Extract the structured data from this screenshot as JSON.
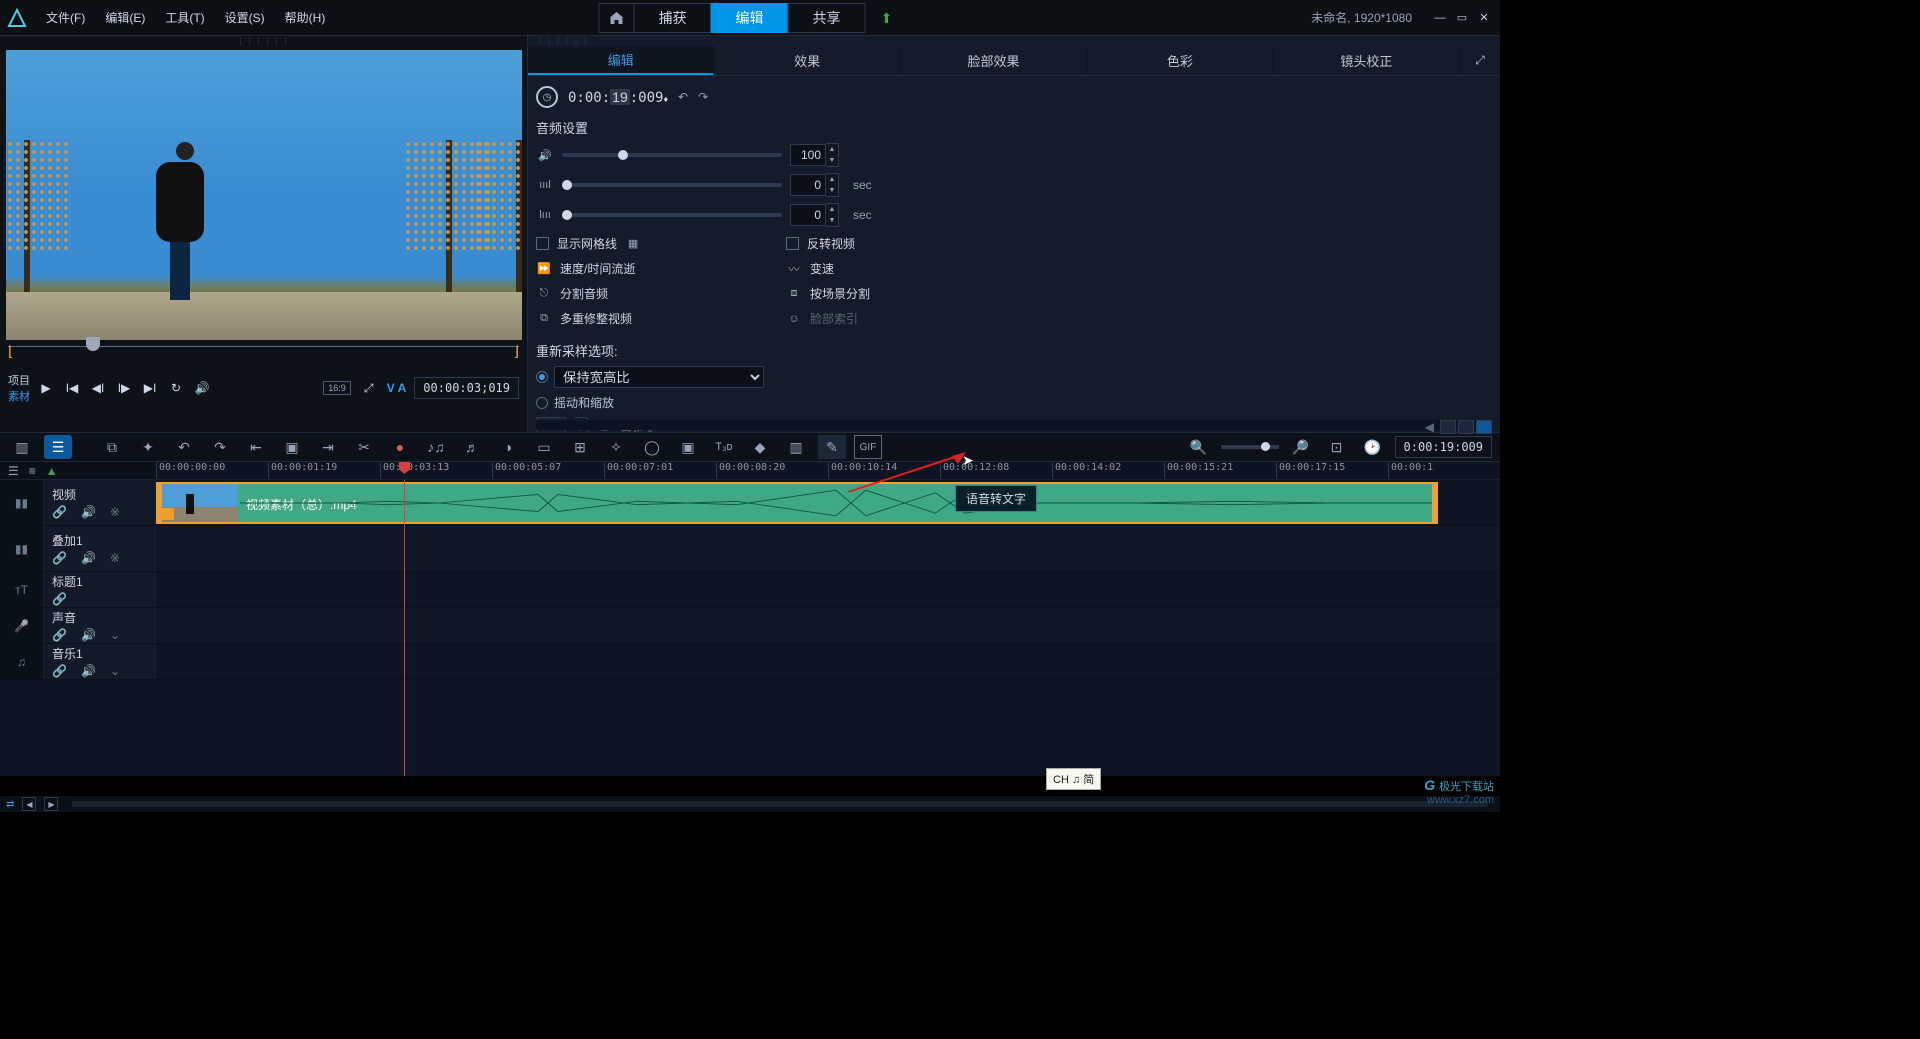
{
  "app": {
    "project_info": "未命名, 1920*1080"
  },
  "menu": [
    "文件(F)",
    "编辑(E)",
    "工具(T)",
    "设置(S)",
    "帮助(H)"
  ],
  "modes": {
    "capture": "捕获",
    "edit": "编辑",
    "share": "共享",
    "active": "编辑"
  },
  "preview": {
    "labels": {
      "project": "项目",
      "clip": "素材"
    },
    "timecode": "00:00:03;019",
    "aspect": "16:9",
    "va": "V A",
    "marker_in": "[",
    "marker_out": "]"
  },
  "edit_panel": {
    "tabs": [
      "编辑",
      "效果",
      "脸部效果",
      "色彩",
      "镜头校正"
    ],
    "active": "编辑",
    "timecode": "0:00:19:009",
    "audio_header": "音频设置",
    "sliders": {
      "volume": {
        "value": "100"
      },
      "fadein": {
        "value": "0",
        "unit": "sec"
      },
      "fadeout": {
        "value": "0",
        "unit": "sec"
      }
    },
    "checks": {
      "grid": "显示网格线",
      "reverse": "反转视频"
    },
    "tools": {
      "speed": "速度/时间流逝",
      "varrate": "变速",
      "split": "分割音频",
      "scene": "按场景分割",
      "multi": "多重修整视频",
      "face": "脸部索引"
    },
    "resample": {
      "header": "重新采样选项:",
      "keep": "保持宽高比",
      "panzoom": "摇动和缩放",
      "custom": "自定义"
    }
  },
  "toolbar": {
    "timecode": "0:00:19:009"
  },
  "ruler": [
    "00:00:00:00",
    "00:00:01:19",
    "00:00:03:13",
    "00:00:05:07",
    "00:00:07:01",
    "00:00:08:20",
    "00:00:10:14",
    "00:00:12:08",
    "00:00:14:02",
    "00:00:15:21",
    "00:00:17:15",
    "00:00:1"
  ],
  "tracks": {
    "video": "视频",
    "overlay": "叠加1",
    "title": "标题1",
    "voice": "声音",
    "music": "音乐1"
  },
  "clip": {
    "name": "视频素材（总）.mp4"
  },
  "tooltip": "语音转文字",
  "ime": "CH ♫ 简",
  "watermark": {
    "brand": "极光下载站",
    "url": "www.xz7.com"
  }
}
